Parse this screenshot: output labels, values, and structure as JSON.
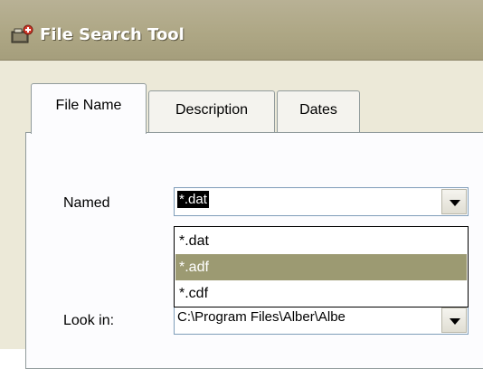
{
  "window": {
    "title": "File Search Tool",
    "title_icon": "folder-search-icon"
  },
  "tabs": [
    {
      "label": "File Name",
      "active": true
    },
    {
      "label": "Description",
      "active": false
    },
    {
      "label": "Dates",
      "active": false
    }
  ],
  "form": {
    "named_label": "Named",
    "named_value": "*.dat",
    "named_options": [
      "*.dat",
      "*.adf",
      "*.cdf"
    ],
    "highlighted_option": "*.adf",
    "look_in_label": "Look in:",
    "look_in_value": "C:\\Program Files\\Alber\\Albe"
  },
  "colors": {
    "titlebar": "#aea785",
    "highlight": "#9c9a72",
    "panel": "#fcfcfe"
  }
}
